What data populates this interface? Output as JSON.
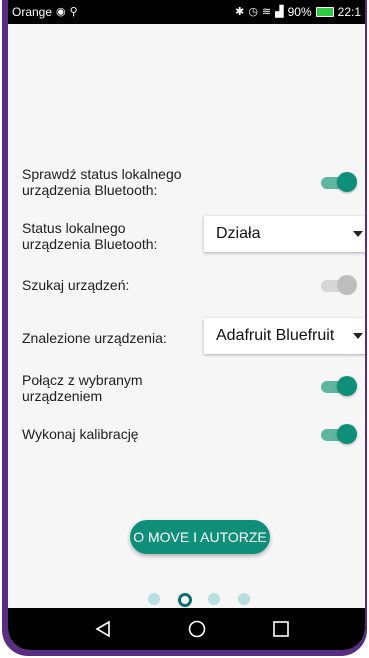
{
  "status_bar": {
    "carrier": "Orange",
    "signal_text": "\"",
    "battery_percent": "90%",
    "time": "22:1"
  },
  "settings": {
    "row1_label": "Sprawdź status lokalnego urządzenia Bluetooth:",
    "row1_toggle": true,
    "row2_label": "Status lokalnego urządzenia Bluetooth:",
    "row2_value": "Działa",
    "row3_label": "Szukaj urządzeń:",
    "row3_toggle": "disabled",
    "row4_label": "Znalezione urządzenia:",
    "row4_value": "Adafruit Bluefruit",
    "row5_label": "Połącz z wybranym urządzeniem",
    "row5_toggle": true,
    "row6_label": "Wykonaj kalibrację",
    "row6_toggle": true
  },
  "about_button": "O MOVE I AUTORZE",
  "pager": {
    "count": 4,
    "active_index": 1
  },
  "colors": {
    "accent": "#0f8f79",
    "frame": "#5a2d82"
  }
}
